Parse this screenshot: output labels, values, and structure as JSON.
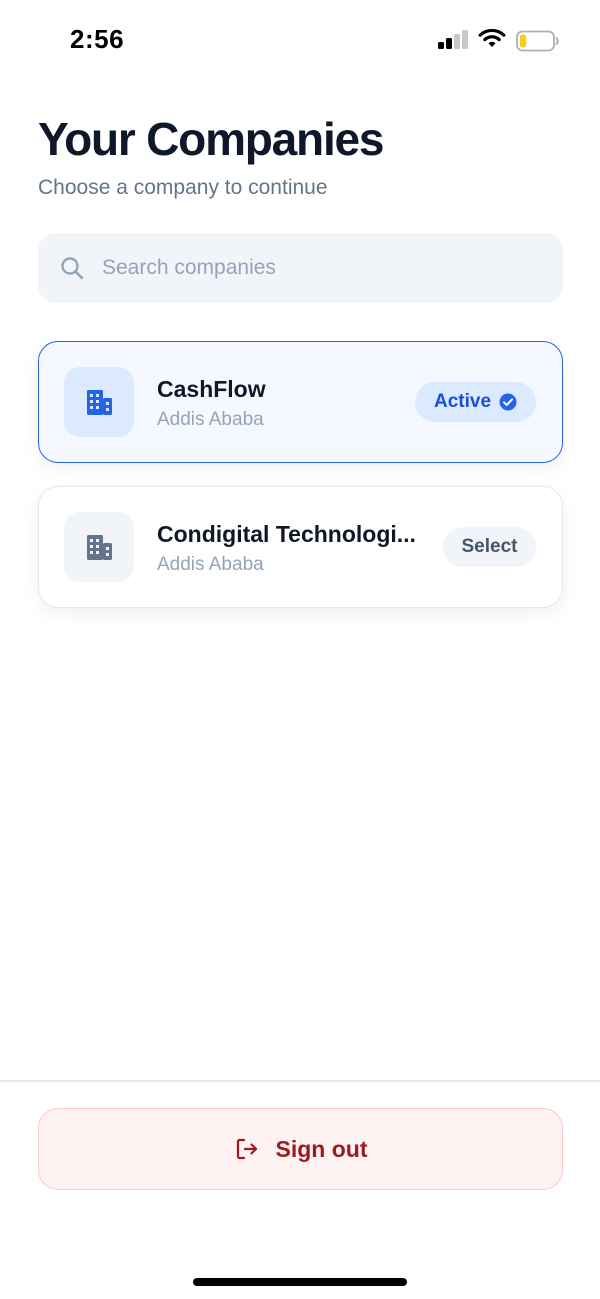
{
  "status_bar": {
    "time": "2:56",
    "icons": [
      "cellular-signal-icon",
      "wifi-icon",
      "battery-icon"
    ],
    "battery_level_fraction": 0.2,
    "battery_color": "#facc15"
  },
  "header": {
    "title": "Your Companies",
    "subtitle": "Choose a company to continue"
  },
  "search": {
    "placeholder": "Search companies",
    "value": "",
    "icon": "search-icon"
  },
  "companies": [
    {
      "name": "CashFlow",
      "location": "Addis Ababa",
      "icon": "building-icon",
      "status_label": "Active",
      "is_active": true,
      "icon_color": "#2563eb"
    },
    {
      "name": "Condigital Technologi...",
      "location": "Addis Ababa",
      "icon": "building-icon",
      "status_label": "Select",
      "is_active": false,
      "icon_color": "#64748b"
    }
  ],
  "footer": {
    "signout_label": "Sign out",
    "signout_icon": "sign-out-icon",
    "signout_color": "#991b1b"
  },
  "colors": {
    "accent": "#2563eb",
    "title": "#0f172a",
    "muted": "#64748b",
    "danger_bg": "#fef2f2"
  }
}
